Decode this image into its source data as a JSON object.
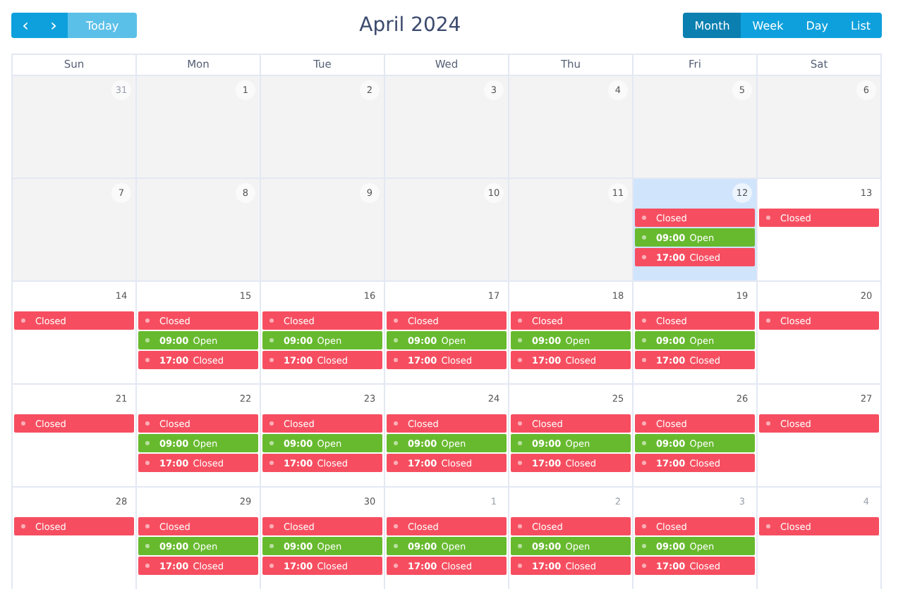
{
  "toolbar": {
    "prev": "‹",
    "next": "›",
    "today": "Today",
    "title": "April 2024",
    "views": [
      {
        "label": "Month",
        "selected": true
      },
      {
        "label": "Week",
        "selected": false
      },
      {
        "label": "Day",
        "selected": false
      },
      {
        "label": "List",
        "selected": false
      }
    ]
  },
  "weekdays": [
    "Sun",
    "Mon",
    "Tue",
    "Wed",
    "Thu",
    "Fri",
    "Sat"
  ],
  "weeks": [
    [
      {
        "day": "31",
        "past": true,
        "other_month": true,
        "today": false
      },
      {
        "day": "1",
        "past": true,
        "other_month": false,
        "today": false
      },
      {
        "day": "2",
        "past": true,
        "other_month": false,
        "today": false
      },
      {
        "day": "3",
        "past": true,
        "other_month": false,
        "today": false
      },
      {
        "day": "4",
        "past": true,
        "other_month": false,
        "today": false
      },
      {
        "day": "5",
        "past": true,
        "other_month": false,
        "today": false
      },
      {
        "day": "6",
        "past": true,
        "other_month": false,
        "today": false
      }
    ],
    [
      {
        "day": "7",
        "past": true,
        "other_month": false,
        "today": false
      },
      {
        "day": "8",
        "past": true,
        "other_month": false,
        "today": false
      },
      {
        "day": "9",
        "past": true,
        "other_month": false,
        "today": false
      },
      {
        "day": "10",
        "past": true,
        "other_month": false,
        "today": false
      },
      {
        "day": "11",
        "past": true,
        "other_month": false,
        "today": false
      },
      {
        "day": "12",
        "past": false,
        "other_month": false,
        "today": true,
        "events": [
          {
            "title": "Closed",
            "color": "#f64e60"
          },
          {
            "time": "09:00",
            "title": "Open",
            "color": "#67ba2e"
          },
          {
            "time": "17:00",
            "title": "Closed",
            "color": "#f64e60"
          }
        ]
      },
      {
        "day": "13",
        "past": false,
        "other_month": false,
        "today": false,
        "events": [
          {
            "title": "Closed",
            "color": "#f64e60"
          }
        ]
      }
    ],
    [
      {
        "day": "14",
        "past": false,
        "other_month": false,
        "today": false,
        "events": [
          {
            "title": "Closed",
            "color": "#f64e60"
          }
        ]
      },
      {
        "day": "15",
        "past": false,
        "other_month": false,
        "today": false,
        "events": [
          {
            "title": "Closed",
            "color": "#f64e60"
          },
          {
            "time": "09:00",
            "title": "Open",
            "color": "#67ba2e"
          },
          {
            "time": "17:00",
            "title": "Closed",
            "color": "#f64e60"
          }
        ]
      },
      {
        "day": "16",
        "past": false,
        "other_month": false,
        "today": false,
        "events": [
          {
            "title": "Closed",
            "color": "#f64e60"
          },
          {
            "time": "09:00",
            "title": "Open",
            "color": "#67ba2e"
          },
          {
            "time": "17:00",
            "title": "Closed",
            "color": "#f64e60"
          }
        ]
      },
      {
        "day": "17",
        "past": false,
        "other_month": false,
        "today": false,
        "events": [
          {
            "title": "Closed",
            "color": "#f64e60"
          },
          {
            "time": "09:00",
            "title": "Open",
            "color": "#67ba2e"
          },
          {
            "time": "17:00",
            "title": "Closed",
            "color": "#f64e60"
          }
        ]
      },
      {
        "day": "18",
        "past": false,
        "other_month": false,
        "today": false,
        "events": [
          {
            "title": "Closed",
            "color": "#f64e60"
          },
          {
            "time": "09:00",
            "title": "Open",
            "color": "#67ba2e"
          },
          {
            "time": "17:00",
            "title": "Closed",
            "color": "#f64e60"
          }
        ]
      },
      {
        "day": "19",
        "past": false,
        "other_month": false,
        "today": false,
        "events": [
          {
            "title": "Closed",
            "color": "#f64e60"
          },
          {
            "time": "09:00",
            "title": "Open",
            "color": "#67ba2e"
          },
          {
            "time": "17:00",
            "title": "Closed",
            "color": "#f64e60"
          }
        ]
      },
      {
        "day": "20",
        "past": false,
        "other_month": false,
        "today": false,
        "events": [
          {
            "title": "Closed",
            "color": "#f64e60"
          }
        ]
      }
    ],
    [
      {
        "day": "21",
        "past": false,
        "other_month": false,
        "today": false,
        "events": [
          {
            "title": "Closed",
            "color": "#f64e60"
          }
        ]
      },
      {
        "day": "22",
        "past": false,
        "other_month": false,
        "today": false,
        "events": [
          {
            "title": "Closed",
            "color": "#f64e60"
          },
          {
            "time": "09:00",
            "title": "Open",
            "color": "#67ba2e"
          },
          {
            "time": "17:00",
            "title": "Closed",
            "color": "#f64e60"
          }
        ]
      },
      {
        "day": "23",
        "past": false,
        "other_month": false,
        "today": false,
        "events": [
          {
            "title": "Closed",
            "color": "#f64e60"
          },
          {
            "time": "09:00",
            "title": "Open",
            "color": "#67ba2e"
          },
          {
            "time": "17:00",
            "title": "Closed",
            "color": "#f64e60"
          }
        ]
      },
      {
        "day": "24",
        "past": false,
        "other_month": false,
        "today": false,
        "events": [
          {
            "title": "Closed",
            "color": "#f64e60"
          },
          {
            "time": "09:00",
            "title": "Open",
            "color": "#67ba2e"
          },
          {
            "time": "17:00",
            "title": "Closed",
            "color": "#f64e60"
          }
        ]
      },
      {
        "day": "25",
        "past": false,
        "other_month": false,
        "today": false,
        "events": [
          {
            "title": "Closed",
            "color": "#f64e60"
          },
          {
            "time": "09:00",
            "title": "Open",
            "color": "#67ba2e"
          },
          {
            "time": "17:00",
            "title": "Closed",
            "color": "#f64e60"
          }
        ]
      },
      {
        "day": "26",
        "past": false,
        "other_month": false,
        "today": false,
        "events": [
          {
            "title": "Closed",
            "color": "#f64e60"
          },
          {
            "time": "09:00",
            "title": "Open",
            "color": "#67ba2e"
          },
          {
            "time": "17:00",
            "title": "Closed",
            "color": "#f64e60"
          }
        ]
      },
      {
        "day": "27",
        "past": false,
        "other_month": false,
        "today": false,
        "events": [
          {
            "title": "Closed",
            "color": "#f64e60"
          }
        ]
      }
    ],
    [
      {
        "day": "28",
        "past": false,
        "other_month": false,
        "today": false,
        "events": [
          {
            "title": "Closed",
            "color": "#f64e60"
          }
        ]
      },
      {
        "day": "29",
        "past": false,
        "other_month": false,
        "today": false,
        "events": [
          {
            "title": "Closed",
            "color": "#f64e60"
          },
          {
            "time": "09:00",
            "title": "Open",
            "color": "#67ba2e"
          },
          {
            "time": "17:00",
            "title": "Closed",
            "color": "#f64e60"
          }
        ]
      },
      {
        "day": "30",
        "past": false,
        "other_month": false,
        "today": false,
        "events": [
          {
            "title": "Closed",
            "color": "#f64e60"
          },
          {
            "time": "09:00",
            "title": "Open",
            "color": "#67ba2e"
          },
          {
            "time": "17:00",
            "title": "Closed",
            "color": "#f64e60"
          }
        ]
      },
      {
        "day": "1",
        "past": false,
        "other_month": true,
        "today": false,
        "events": [
          {
            "title": "Closed",
            "color": "#f64e60"
          },
          {
            "time": "09:00",
            "title": "Open",
            "color": "#67ba2e"
          },
          {
            "time": "17:00",
            "title": "Closed",
            "color": "#f64e60"
          }
        ]
      },
      {
        "day": "2",
        "past": false,
        "other_month": true,
        "today": false,
        "events": [
          {
            "title": "Closed",
            "color": "#f64e60"
          },
          {
            "time": "09:00",
            "title": "Open",
            "color": "#67ba2e"
          },
          {
            "time": "17:00",
            "title": "Closed",
            "color": "#f64e60"
          }
        ]
      },
      {
        "day": "3",
        "past": false,
        "other_month": true,
        "today": false,
        "events": [
          {
            "title": "Closed",
            "color": "#f64e60"
          },
          {
            "time": "09:00",
            "title": "Open",
            "color": "#67ba2e"
          },
          {
            "time": "17:00",
            "title": "Closed",
            "color": "#f64e60"
          }
        ]
      },
      {
        "day": "4",
        "past": false,
        "other_month": true,
        "today": false,
        "events": [
          {
            "title": "Closed",
            "color": "#f64e60"
          }
        ]
      }
    ]
  ]
}
